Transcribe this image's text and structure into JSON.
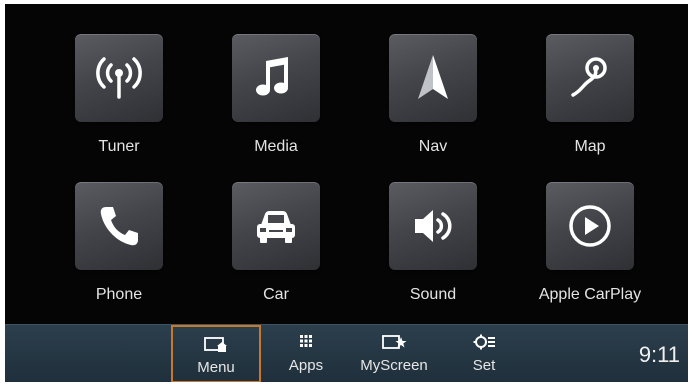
{
  "apps": [
    {
      "label": "Tuner",
      "icon": "radio-tower-icon"
    },
    {
      "label": "Media",
      "icon": "music-note-icon"
    },
    {
      "label": "Nav",
      "icon": "navigation-arrow-icon"
    },
    {
      "label": "Map",
      "icon": "map-route-icon"
    },
    {
      "label": "Phone",
      "icon": "phone-handset-icon"
    },
    {
      "label": "Car",
      "icon": "car-icon"
    },
    {
      "label": "Sound",
      "icon": "speaker-icon"
    },
    {
      "label": "Apple CarPlay",
      "icon": "play-circle-icon"
    }
  ],
  "bottom_bar": {
    "buttons": [
      {
        "label": "Menu",
        "icon": "menu-home-icon",
        "active": true
      },
      {
        "label": "Apps",
        "icon": "apps-grid-icon",
        "active": false
      },
      {
        "label": "MyScreen",
        "icon": "myscreen-star-icon",
        "active": false
      },
      {
        "label": "Set",
        "icon": "settings-icon",
        "active": false
      }
    ],
    "clock": "9:11"
  },
  "colors": {
    "screen_background": "#050506",
    "tile": "#46484d",
    "bottom_bar": "#253744",
    "active_outline": "#c7782a"
  }
}
